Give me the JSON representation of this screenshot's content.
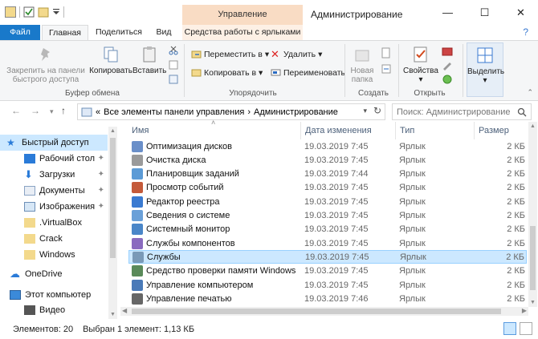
{
  "titlebar": {
    "context_label": "Управление",
    "title": "Администрирование",
    "minimize": "—",
    "maximize": "☐",
    "close": "✕"
  },
  "tabs": {
    "file": "Файл",
    "home": "Главная",
    "share": "Поделиться",
    "view": "Вид",
    "shortcut_tools": "Средства работы с ярлыками",
    "help": "?"
  },
  "ribbon": {
    "pin": "Закрепить на панели быстрого доступа",
    "copy": "Копировать",
    "paste": "Вставить",
    "clipboard_group": "Буфер обмена",
    "move_to": "Переместить в",
    "copy_to": "Копировать в",
    "delete": "Удалить",
    "rename": "Переименовать",
    "organize_group": "Упорядочить",
    "new_folder": "Новая папка",
    "create_group": "Создать",
    "properties": "Свойства",
    "open_group": "Открыть",
    "select": "Выделить"
  },
  "address": {
    "path_prefix": "«",
    "path_1": "Все элементы панели управления",
    "sep": "›",
    "path_2": "Администрирование",
    "search_placeholder": "Поиск: Администрирование"
  },
  "nav": {
    "items": [
      {
        "label": "Быстрый доступ",
        "pinned": false
      },
      {
        "label": "Рабочий стол",
        "pinned": true
      },
      {
        "label": "Загрузки",
        "pinned": true
      },
      {
        "label": "Документы",
        "pinned": true
      },
      {
        "label": "Изображения",
        "pinned": true
      },
      {
        "label": ".VirtualBox",
        "pinned": false
      },
      {
        "label": "Crack",
        "pinned": false
      },
      {
        "label": "Windows",
        "pinned": false
      },
      {
        "label": "OneDrive",
        "pinned": false
      },
      {
        "label": "Этот компьютер",
        "pinned": false
      },
      {
        "label": "Видео",
        "pinned": false
      }
    ],
    "pin_glyph": "✦"
  },
  "columns": {
    "name": "Имя",
    "date": "Дата изменения",
    "type": "Тип",
    "size": "Размер"
  },
  "files": [
    {
      "name": "Оптимизация дисков",
      "date": "19.03.2019 7:45",
      "type": "Ярлык",
      "size": "2 КБ"
    },
    {
      "name": "Очистка диска",
      "date": "19.03.2019 7:45",
      "type": "Ярлык",
      "size": "2 КБ"
    },
    {
      "name": "Планировщик заданий",
      "date": "19.03.2019 7:44",
      "type": "Ярлык",
      "size": "2 КБ"
    },
    {
      "name": "Просмотр событий",
      "date": "19.03.2019 7:45",
      "type": "Ярлык",
      "size": "2 КБ"
    },
    {
      "name": "Редактор реестра",
      "date": "19.03.2019 7:45",
      "type": "Ярлык",
      "size": "2 КБ"
    },
    {
      "name": "Сведения о системе",
      "date": "19.03.2019 7:45",
      "type": "Ярлык",
      "size": "2 КБ"
    },
    {
      "name": "Системный монитор",
      "date": "19.03.2019 7:45",
      "type": "Ярлык",
      "size": "2 КБ"
    },
    {
      "name": "Службы компонентов",
      "date": "19.03.2019 7:45",
      "type": "Ярлык",
      "size": "2 КБ"
    },
    {
      "name": "Службы",
      "date": "19.03.2019 7:45",
      "type": "Ярлык",
      "size": "2 КБ"
    },
    {
      "name": "Средство проверки памяти Windows",
      "date": "19.03.2019 7:45",
      "type": "Ярлык",
      "size": "2 КБ"
    },
    {
      "name": "Управление компьютером",
      "date": "19.03.2019 7:45",
      "type": "Ярлык",
      "size": "2 КБ"
    },
    {
      "name": "Управление печатью",
      "date": "19.03.2019 7:46",
      "type": "Ярлык",
      "size": "2 КБ"
    }
  ],
  "status": {
    "count": "Элементов: 20",
    "selection": "Выбран 1 элемент: 1,13 КБ"
  },
  "colors": {
    "file_tab": "#1979ca",
    "context_tab": "#f9dcc4",
    "selection": "#cce8ff",
    "header_text": "#4c607a"
  }
}
